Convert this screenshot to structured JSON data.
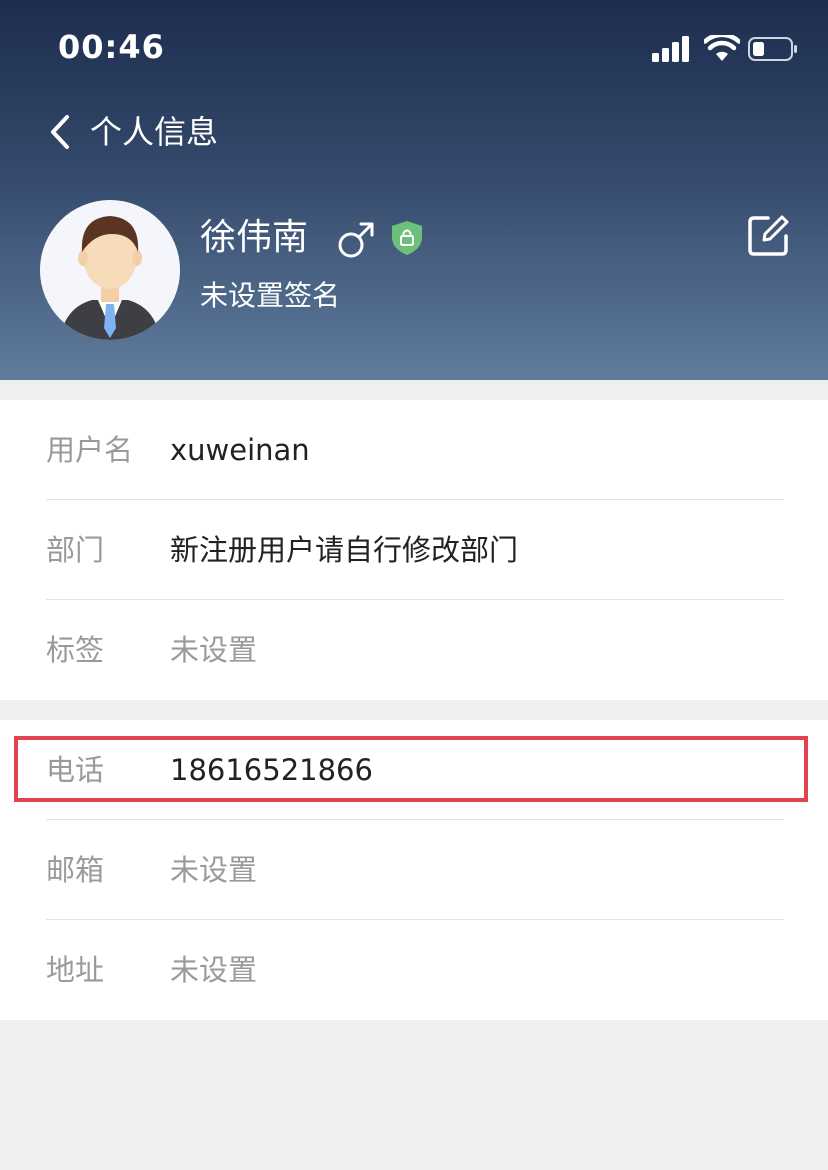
{
  "status_bar": {
    "time": "00:46"
  },
  "nav": {
    "title": "个人信息"
  },
  "profile": {
    "name": "徐伟南",
    "signature": "未设置签名"
  },
  "info": {
    "username_label": "用户名",
    "username_value": "xuweinan",
    "department_label": "部门",
    "department_value": "新注册用户请自行修改部门",
    "tags_label": "标签",
    "tags_value": "未设置"
  },
  "contact": {
    "phone_label": "电话",
    "phone_value": "18616521866",
    "email_label": "邮箱",
    "email_value": "未设置",
    "address_label": "地址",
    "address_value": "未设置"
  },
  "colors": {
    "header_top": "#1d2d4f",
    "header_bottom": "#5f7c9c",
    "highlight": "#e3434f",
    "shield": "#6cc07a",
    "muted_text": "#9a9a9a"
  },
  "icons": [
    "signal-icon",
    "wifi-icon",
    "battery-icon",
    "back-arrow-icon",
    "male-icon",
    "shield-lock-icon",
    "edit-icon",
    "avatar"
  ]
}
